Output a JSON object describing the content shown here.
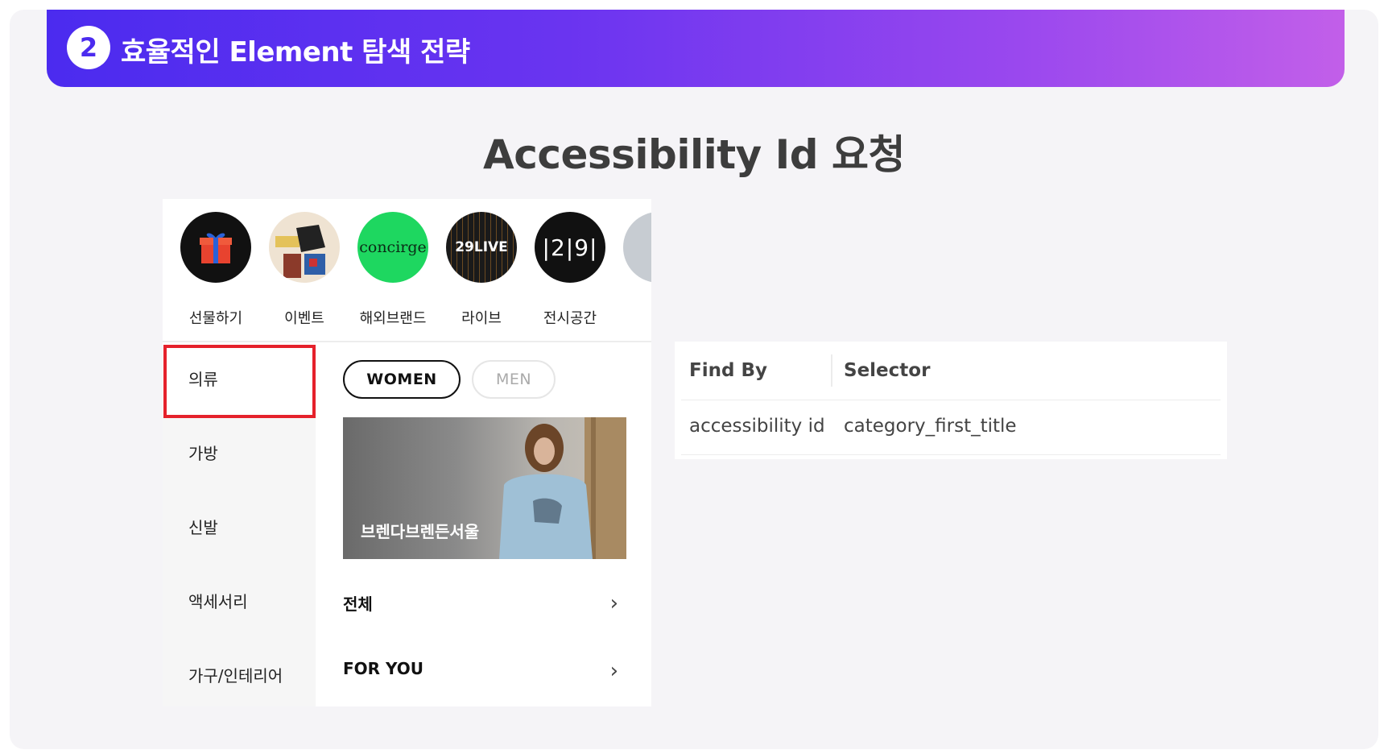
{
  "header": {
    "badge_number": "2",
    "title": "효율적인 Element 탐색 전략"
  },
  "slide_title": "Accessibility Id 요청",
  "stories": [
    {
      "label": "선물하기",
      "icon": "gift-icon"
    },
    {
      "label": "이벤트",
      "icon": "event-icon"
    },
    {
      "label": "해외브랜드",
      "icon": "concierge-logo",
      "logo_text": "concirge"
    },
    {
      "label": "라이브",
      "icon": "live-logo",
      "logo_text": "29LIVE"
    },
    {
      "label": "전시공간",
      "icon": "exhibition-logo",
      "logo_text": "|2|9|"
    }
  ],
  "categories": [
    "의류",
    "가방",
    "신발",
    "액세서리",
    "가구/인테리어"
  ],
  "gender_tabs": {
    "women": "WOMEN",
    "men": "MEN"
  },
  "banner": {
    "caption": "브렌다브렌든서울"
  },
  "links": [
    {
      "label": "전체",
      "chevron": "›"
    },
    {
      "label": "FOR YOU",
      "chevron": "›"
    }
  ],
  "table": {
    "headers": [
      "Find By",
      "Selector"
    ],
    "rows": [
      [
        "accessibility id",
        "category_first_title"
      ]
    ]
  },
  "colors": {
    "banner_start": "#4b2bef",
    "banner_end": "#c25fe9",
    "highlight": "#e5212b",
    "concierge_bg": "#1ed760"
  }
}
